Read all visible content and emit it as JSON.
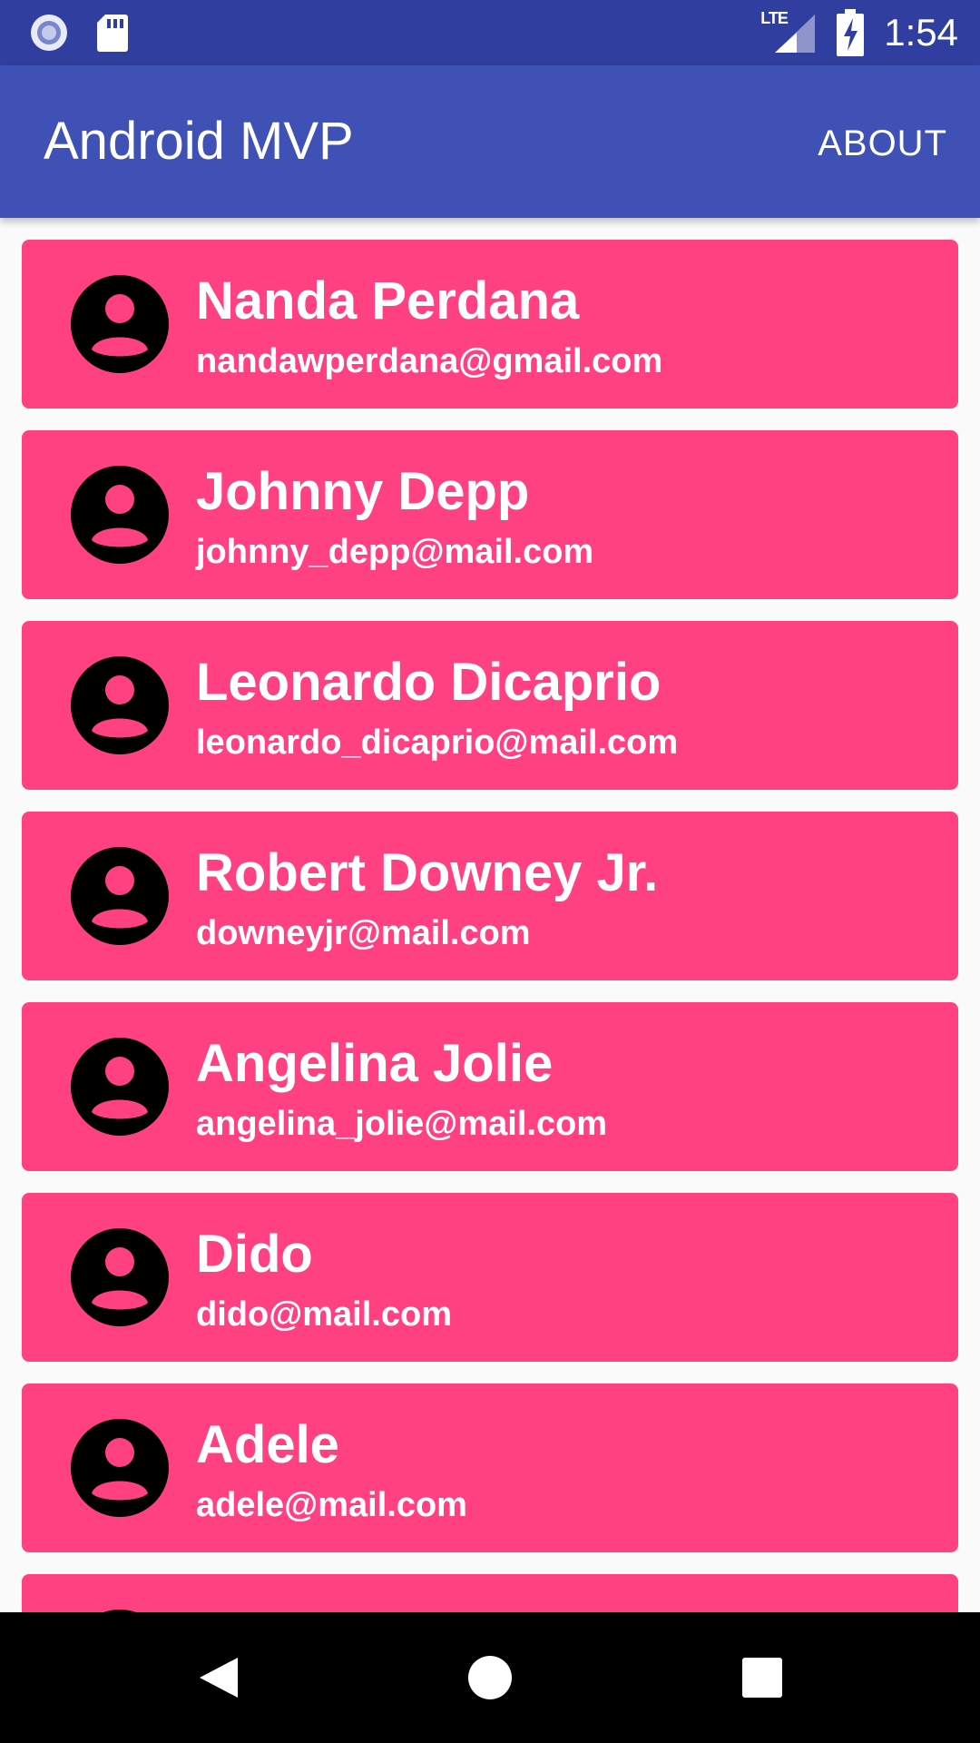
{
  "status_bar": {
    "time": "1:54",
    "network": "LTE",
    "icons": [
      "notification-circle-icon",
      "sd-card-icon",
      "lte-signal-icon",
      "battery-charging-icon"
    ]
  },
  "app_bar": {
    "title": "Android MVP",
    "about_label": "ABOUT"
  },
  "contacts": [
    {
      "name": "Nanda Perdana",
      "email": "nandawperdana@gmail.com"
    },
    {
      "name": "Johnny Depp",
      "email": "johnny_depp@mail.com"
    },
    {
      "name": "Leonardo Dicaprio",
      "email": "leonardo_dicaprio@mail.com"
    },
    {
      "name": "Robert Downey Jr.",
      "email": "downeyjr@mail.com"
    },
    {
      "name": "Angelina Jolie",
      "email": "angelina_jolie@mail.com"
    },
    {
      "name": "Dido",
      "email": "dido@mail.com"
    },
    {
      "name": "Adele",
      "email": "adele@mail.com"
    },
    {
      "name": "",
      "email": ""
    }
  ],
  "nav_bar": {
    "icons": [
      "back-icon",
      "home-icon",
      "recents-icon"
    ]
  },
  "colors": {
    "status_bar": "#303F9F",
    "app_bar": "#3F51B5",
    "card": "#FF4081",
    "background": "#FAFAFA",
    "nav_bar": "#000000"
  }
}
